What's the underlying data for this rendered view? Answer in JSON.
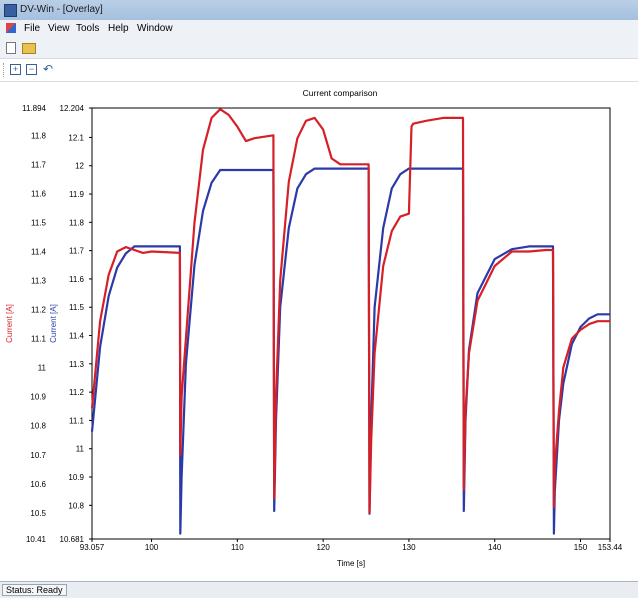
{
  "window": {
    "title": "DV-Win - [Overlay]"
  },
  "menu": [
    {
      "label": "File"
    },
    {
      "label": "View"
    },
    {
      "label": "Tools"
    },
    {
      "label": "Help"
    },
    {
      "label": "Window"
    }
  ],
  "toolbar": {
    "icons": [
      "new-document-icon",
      "open-folder-icon",
      "zoom-in-icon",
      "zoom-out-icon",
      "undo-icon"
    ]
  },
  "status": {
    "text": "Status: Ready"
  },
  "colors": {
    "red_series": "#d62027",
    "blue_series": "#2b3aa8"
  },
  "chart_data": {
    "type": "line",
    "title": "Current comparison",
    "xlabel": "Time [s]",
    "xlim": [
      93.057,
      153.44
    ],
    "x_ticks": [
      "93.057",
      "100",
      "110",
      "120",
      "130",
      "140",
      "150",
      "153.44"
    ],
    "y_axes": [
      {
        "label": "Current [A]",
        "color": "#d62027",
        "ylim": [
          10.41,
          11.894
        ],
        "ticks": [
          "11.894",
          "11.8",
          "11.7",
          "11.6",
          "11.5",
          "11.4",
          "11.3",
          "11.2",
          "11.1",
          "11",
          "10.9",
          "10.8",
          "10.7",
          "10.6",
          "10.5",
          "10.41"
        ]
      },
      {
        "label": "Current [A]",
        "color": "#2b3aa8",
        "ylim": [
          10.681,
          12.204
        ],
        "ticks": [
          "12.204",
          "12.1",
          "12",
          "11.9",
          "11.8",
          "11.7",
          "11.6",
          "11.5",
          "11.4",
          "11.3",
          "11.2",
          "11.1",
          "11",
          "10.9",
          "10.8",
          "10.681"
        ]
      }
    ],
    "series": [
      {
        "color": "#2b3aa8",
        "x": [
          93.057,
          94,
          95,
          96,
          97,
          98,
          103.3,
          103.35,
          103.5,
          104,
          105,
          106,
          107,
          108,
          114.2,
          114.3,
          114.5,
          115,
          116,
          117,
          118,
          119,
          125.3,
          125.4,
          125.6,
          126,
          127,
          128,
          129,
          130,
          136.3,
          136.4,
          136.6,
          137,
          138,
          140,
          142,
          144,
          146,
          146.8,
          146.9,
          147,
          147.5,
          148,
          149,
          150,
          151,
          152,
          153.44
        ],
        "y": [
          11.06,
          11.36,
          11.54,
          11.64,
          11.69,
          11.715,
          11.715,
          10.7,
          10.9,
          11.3,
          11.65,
          11.84,
          11.94,
          11.985,
          11.985,
          10.78,
          11.1,
          11.5,
          11.78,
          11.92,
          11.97,
          11.99,
          11.99,
          10.77,
          11.1,
          11.5,
          11.78,
          11.92,
          11.97,
          11.99,
          11.99,
          10.78,
          11.1,
          11.35,
          11.55,
          11.67,
          11.705,
          11.715,
          11.715,
          11.715,
          10.7,
          10.85,
          11.1,
          11.23,
          11.37,
          11.43,
          11.46,
          11.475,
          11.475
        ]
      },
      {
        "color": "#d62027",
        "x": [
          93.057,
          94,
          95,
          96,
          97,
          98,
          99,
          100,
          103.3,
          103.35,
          103.5,
          104,
          105,
          106,
          107,
          108,
          109,
          110,
          111,
          112,
          114.2,
          114.3,
          114.5,
          115,
          116,
          117,
          118,
          119,
          120,
          121,
          122,
          123,
          125.3,
          125.4,
          125.6,
          126,
          127,
          128,
          129,
          130,
          130.3,
          130.5,
          132,
          134,
          136.3,
          136.4,
          136.6,
          137,
          138,
          140,
          142,
          144,
          146,
          146.8,
          146.9,
          147,
          147.5,
          148,
          149,
          150,
          151,
          152,
          153.44
        ],
        "y": [
          10.86,
          11.16,
          11.32,
          11.4,
          11.415,
          11.405,
          11.395,
          11.4,
          11.395,
          10.7,
          10.9,
          11.1,
          11.5,
          11.75,
          11.86,
          11.89,
          11.87,
          11.83,
          11.78,
          11.79,
          11.8,
          10.55,
          10.9,
          11.3,
          11.64,
          11.79,
          11.85,
          11.86,
          11.82,
          11.72,
          11.7,
          11.7,
          11.7,
          10.5,
          10.75,
          11.05,
          11.35,
          11.47,
          11.52,
          11.53,
          11.83,
          11.84,
          11.85,
          11.86,
          11.86,
          10.58,
          10.85,
          11.05,
          11.23,
          11.35,
          11.4,
          11.4,
          11.405,
          11.405,
          10.52,
          10.66,
          10.85,
          11.0,
          11.1,
          11.13,
          11.15,
          11.16,
          11.16
        ]
      }
    ]
  }
}
